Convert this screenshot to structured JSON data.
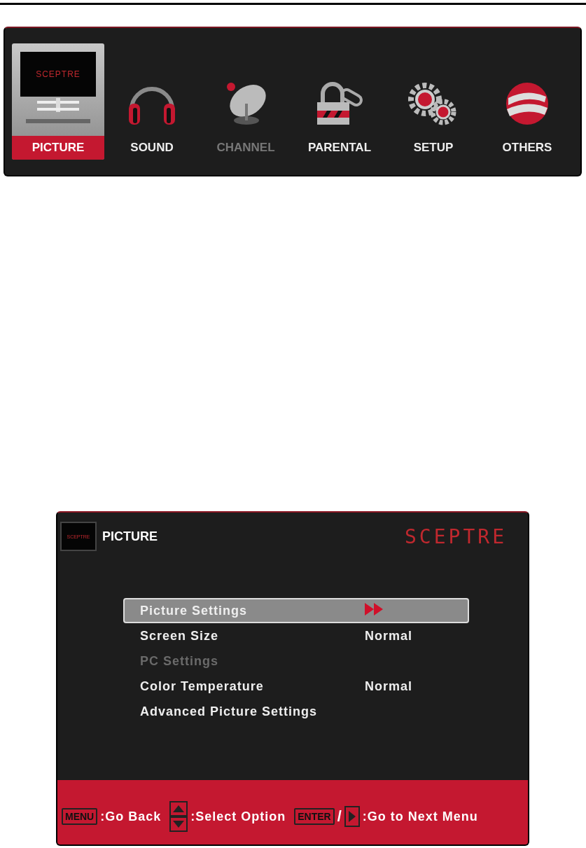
{
  "main_menu": {
    "tabs": [
      {
        "label": "PICTURE",
        "kind": "tv",
        "selected": true,
        "disabled": false,
        "screen_logo": "SCEPTRE"
      },
      {
        "label": "SOUND",
        "kind": "headphones",
        "selected": false,
        "disabled": false
      },
      {
        "label": "CHANNEL",
        "kind": "dish",
        "selected": false,
        "disabled": true
      },
      {
        "label": "PARENTAL",
        "kind": "lock",
        "selected": false,
        "disabled": false
      },
      {
        "label": "SETUP",
        "kind": "gears",
        "selected": false,
        "disabled": false
      },
      {
        "label": "OTHERS",
        "kind": "sphere",
        "selected": false,
        "disabled": false
      }
    ]
  },
  "picture_menu": {
    "title": "PICTURE",
    "icon_logo": "SCEPTRE",
    "brand": "SCEPTRE",
    "items": [
      {
        "label": "Picture Settings",
        "kind": "arrow",
        "selected": true,
        "disabled": false
      },
      {
        "label": "Screen Size",
        "kind": "value",
        "value": "Normal",
        "selected": false,
        "disabled": false
      },
      {
        "label": "PC Settings",
        "kind": "plain",
        "selected": false,
        "disabled": true
      },
      {
        "label": "Color Temperature",
        "kind": "value",
        "value": "Normal",
        "selected": false,
        "disabled": false
      },
      {
        "label": "Advanced Picture Settings",
        "kind": "plain",
        "selected": false,
        "disabled": false
      }
    ],
    "footer": [
      {
        "kind": "key",
        "key": "MENU",
        "text": ":Go Back"
      },
      {
        "kind": "updown",
        "text": ":Select Option"
      },
      {
        "kind": "enter",
        "key": "ENTER",
        "separator": "/",
        "text": ":Go to Next Menu"
      }
    ]
  }
}
